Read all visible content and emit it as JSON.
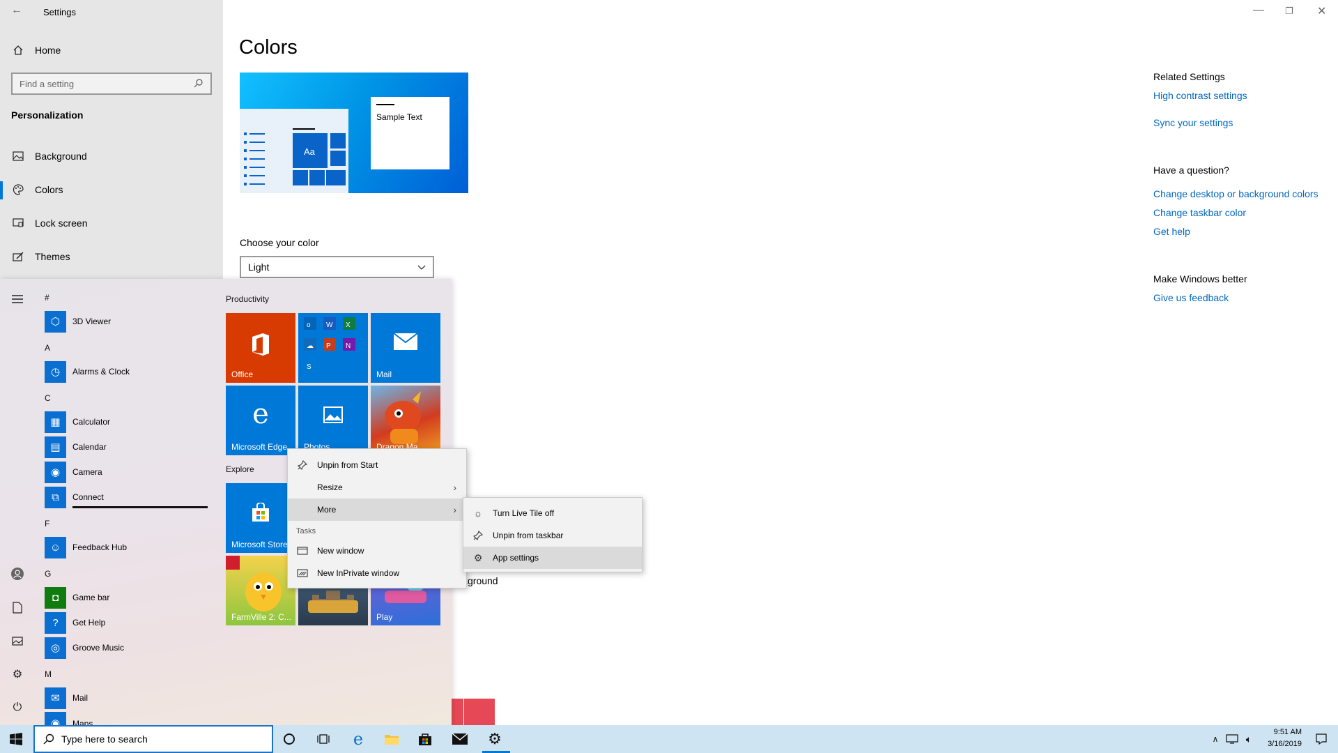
{
  "window": {
    "title": "Settings"
  },
  "nav": {
    "home": "Home",
    "search_placeholder": "Find a setting",
    "section": "Personalization",
    "items": [
      {
        "label": "Background",
        "icon": "picture-icon"
      },
      {
        "label": "Colors",
        "icon": "palette-icon"
      },
      {
        "label": "Lock screen",
        "icon": "lock-screen-icon"
      },
      {
        "label": "Themes",
        "icon": "brush-icon"
      }
    ]
  },
  "main": {
    "title": "Colors",
    "sample_text": "Sample Text",
    "preview_tile_text": "Aa",
    "choose_label": "Choose your color",
    "choose_value": "Light",
    "partial_text": "kground",
    "accent_colors": [
      "#e74856",
      "#e74856"
    ]
  },
  "related": {
    "heading": "Related Settings",
    "links": [
      "High contrast settings",
      "Sync your settings"
    ],
    "question_heading": "Have a question?",
    "question_links": [
      "Change desktop or background colors",
      "Change taskbar color",
      "Get help"
    ],
    "better_heading": "Make Windows better",
    "better_link": "Give us feedback"
  },
  "start": {
    "letters": [
      "#",
      "A",
      "C",
      "F",
      "G",
      "M"
    ],
    "apps": [
      "3D Viewer",
      "Alarms & Clock",
      "Calculator",
      "Calendar",
      "Camera",
      "Connect",
      "Feedback Hub",
      "Game bar",
      "Get Help",
      "Groove Music",
      "Mail",
      "Maps"
    ],
    "groups": [
      "Productivity",
      "Explore"
    ],
    "tiles": [
      "Office",
      "Mail",
      "Microsoft Edge",
      "Photos",
      "Dragon Ma...",
      "Microsoft Store",
      "FarmVille 2: C...",
      "Play"
    ]
  },
  "context_menu": {
    "items": [
      "Unpin from Start",
      "Resize",
      "More"
    ],
    "tasks_label": "Tasks",
    "tasks": [
      "New window",
      "New InPrivate window"
    ]
  },
  "submenu": {
    "items": [
      "Turn Live Tile off",
      "Unpin from taskbar",
      "App settings"
    ]
  },
  "taskbar": {
    "search_placeholder": "Type here to search",
    "time": "9:51 AM",
    "date": "3/16/2019"
  },
  "colors": {
    "accent": "#0078d7",
    "link": "#0067c0",
    "office_tile": "#d83b01",
    "blue_tile": "#0078d7"
  }
}
